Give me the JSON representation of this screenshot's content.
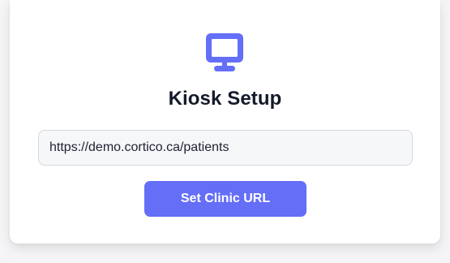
{
  "accent_color": "#646ef7",
  "kiosk": {
    "icon": "monitor-icon",
    "title": "Kiosk Setup",
    "url_input_value": "https://demo.cortico.ca/patients",
    "submit_label": "Set Clinic URL"
  }
}
